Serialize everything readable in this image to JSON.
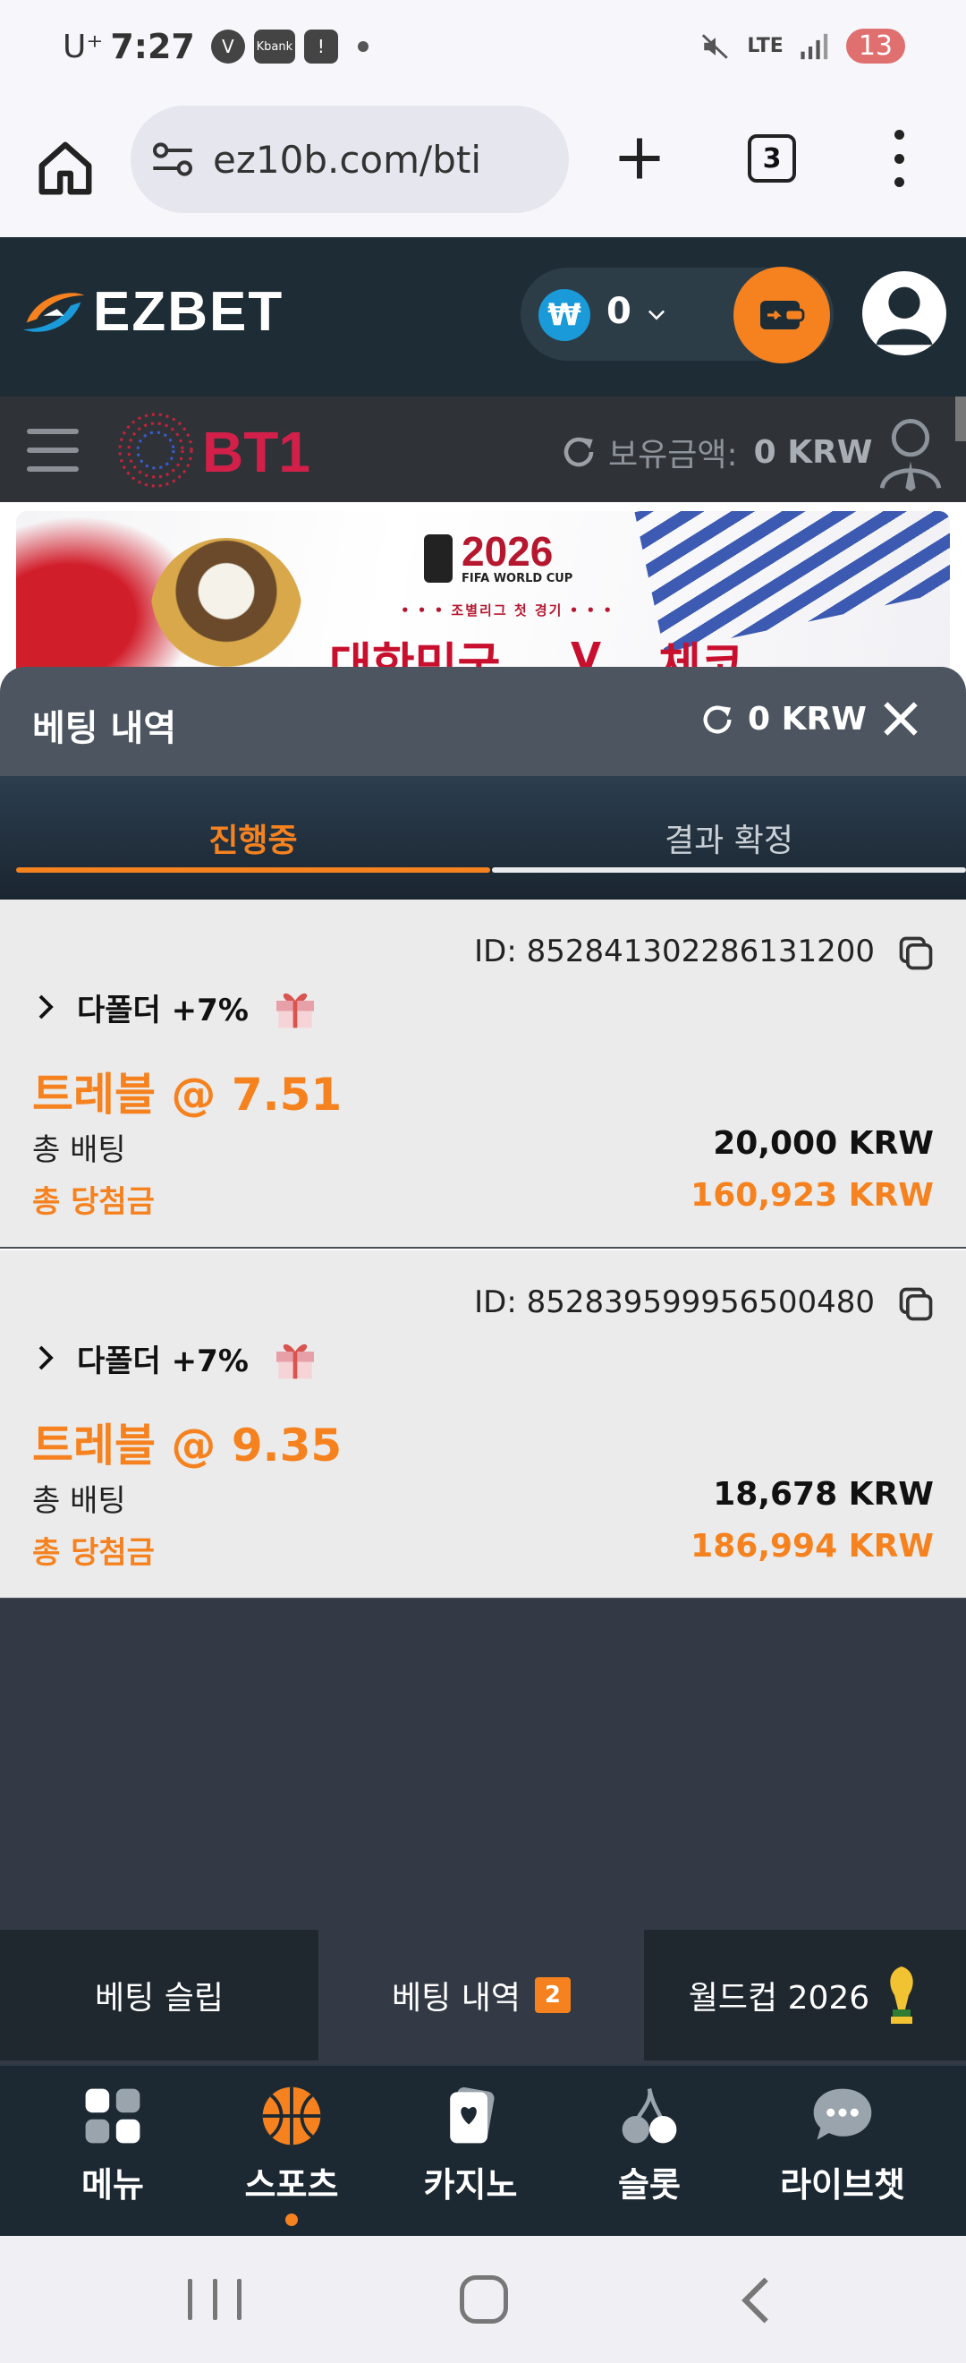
{
  "status_bar": {
    "carrier": "U⁺",
    "time": "7:27",
    "app_icon_v": "V",
    "app_icon_kbank": "Kbank",
    "app_icon_alert": "!",
    "network": "LTE",
    "battery": "13"
  },
  "browser": {
    "url": "ez10b.com/bti",
    "tab_count": "3"
  },
  "site_header": {
    "brand": "EZBET",
    "currency_symbol": "₩",
    "wallet_amount": "0"
  },
  "bt1_header": {
    "logo_text": "BT1",
    "balance_label": "보유금액:",
    "balance_value": "0 KRW"
  },
  "banner": {
    "year": "2026",
    "event": "FIFA WORLD CUP",
    "round": "• • • 조별리그 첫 경기 • • •",
    "team_a": "대한민국",
    "vs": "V",
    "team_b": "체코"
  },
  "bet_history_panel": {
    "title": "베팅 내역",
    "balance": "0 KRW",
    "tabs": [
      {
        "label": "진행중",
        "active": true
      },
      {
        "label": "결과 확정",
        "active": false
      }
    ],
    "bets": [
      {
        "id": "ID: 852841302286131200",
        "bet_type": "다폴더 +7%",
        "odds_label": "트레블 @ 7.51",
        "stake_label": "총 배팅",
        "stake_value": "20,000 KRW",
        "win_label": "총 당첨금",
        "win_value": "160,923 KRW"
      },
      {
        "id": "ID: 852839599956500480",
        "bet_type": "다폴더 +7%",
        "odds_label": "트레블 @ 9.35",
        "stake_label": "총 배팅",
        "stake_value": "18,678 KRW",
        "win_label": "총 당첨금",
        "win_value": "186,994 KRW"
      }
    ]
  },
  "bet_tabs": {
    "slip": "베팅 슬립",
    "history": "베팅 내역",
    "history_badge": "2",
    "worldcup": "월드컵 2026"
  },
  "bottom_nav": [
    {
      "label": "메뉴",
      "icon": "grid-icon"
    },
    {
      "label": "스포츠",
      "icon": "basketball-icon",
      "active": true
    },
    {
      "label": "카지노",
      "icon": "cards-icon"
    },
    {
      "label": "슬롯",
      "icon": "cherry-icon"
    },
    {
      "label": "라이브챗",
      "icon": "chat-bubble-icon"
    }
  ],
  "colors": {
    "accent": "#f5821f",
    "header_bg": "#1e2c36",
    "panel_bg": "#4c5560",
    "card_bg": "#ebebeb",
    "nav_bg": "#1c2832"
  }
}
